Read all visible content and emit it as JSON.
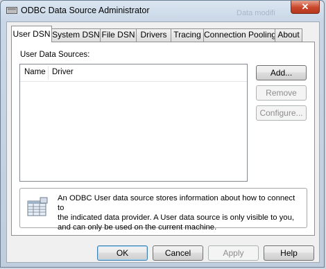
{
  "window": {
    "title": "ODBC Data Source Administrator",
    "faint_background_text": "Data modifi",
    "close_glyph": "✕"
  },
  "tabs": [
    {
      "label": "User DSN",
      "active": true
    },
    {
      "label": "System DSN",
      "active": false
    },
    {
      "label": "File DSN",
      "active": false
    },
    {
      "label": "Drivers",
      "active": false
    },
    {
      "label": "Tracing",
      "active": false
    },
    {
      "label": "Connection Pooling",
      "active": false
    },
    {
      "label": "About",
      "active": false
    }
  ],
  "user_dsn": {
    "section_label": "User Data Sources:",
    "columns": [
      "Name",
      "Driver"
    ],
    "rows": [],
    "buttons": {
      "add": "Add...",
      "remove": "Remove",
      "configure": "Configure..."
    },
    "info_icon": "data-source-table-icon",
    "info_lines": [
      "An ODBC User data source stores information about how to connect to",
      "the indicated data provider.   A User data source is only visible to you,",
      "and can only be used on the current machine."
    ]
  },
  "footer": {
    "ok": "OK",
    "cancel": "Cancel",
    "apply": "Apply",
    "help": "Help"
  },
  "colors": {
    "close_button": "#c9462b",
    "default_button_border": "#3c7fb1",
    "disabled_text": "#8d8d8d"
  }
}
